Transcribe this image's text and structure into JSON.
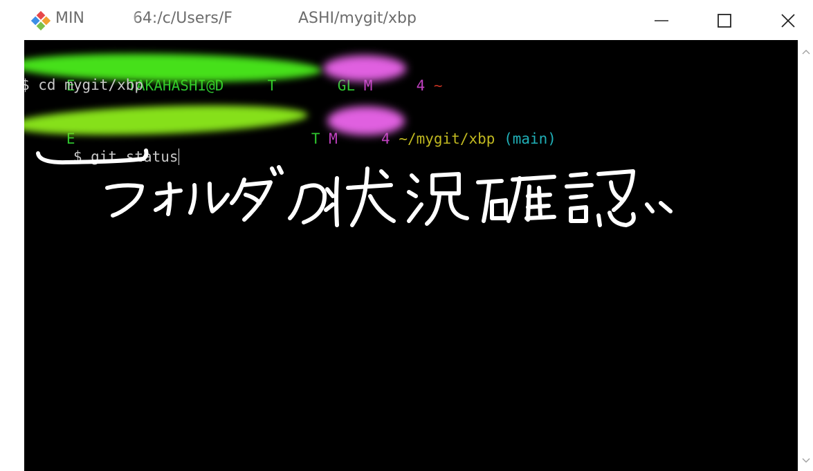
{
  "window": {
    "title": "MIN  64:/c/Users/F     ASHI/mygit/xbp",
    "title_visible_parts": [
      "MIN",
      "64:/c/Users/F",
      "ASHI/mygit/xbp"
    ],
    "minimize_icon": "minimize-icon",
    "maximize_icon": "maximize-icon",
    "close_icon": "close-icon"
  },
  "terminal": {
    "lines": [
      {
        "prompt": {
          "user": "E      TAKAHASHI@D     T       GL",
          "system": "M     4",
          "path": "~"
        }
      },
      {
        "command": "$ cd mygit/xbp"
      },
      {
        "prompt": {
          "user": "E                           T",
          "system": "M     4",
          "path": "~/mygit/xbp",
          "branch": "(main)"
        }
      },
      {
        "command": "$ git status"
      }
    ],
    "annotation": "フォルダの状況確認"
  },
  "colors": {
    "terminal_bg": "#000000",
    "prompt_user": "#2ec42e",
    "prompt_system": "#c040c0",
    "prompt_path": "#c0b820",
    "prompt_branch": "#20b0b8",
    "command_text": "#c8c8c8",
    "redaction_green": "#4ce81a",
    "redaction_pink": "#e060e0"
  }
}
